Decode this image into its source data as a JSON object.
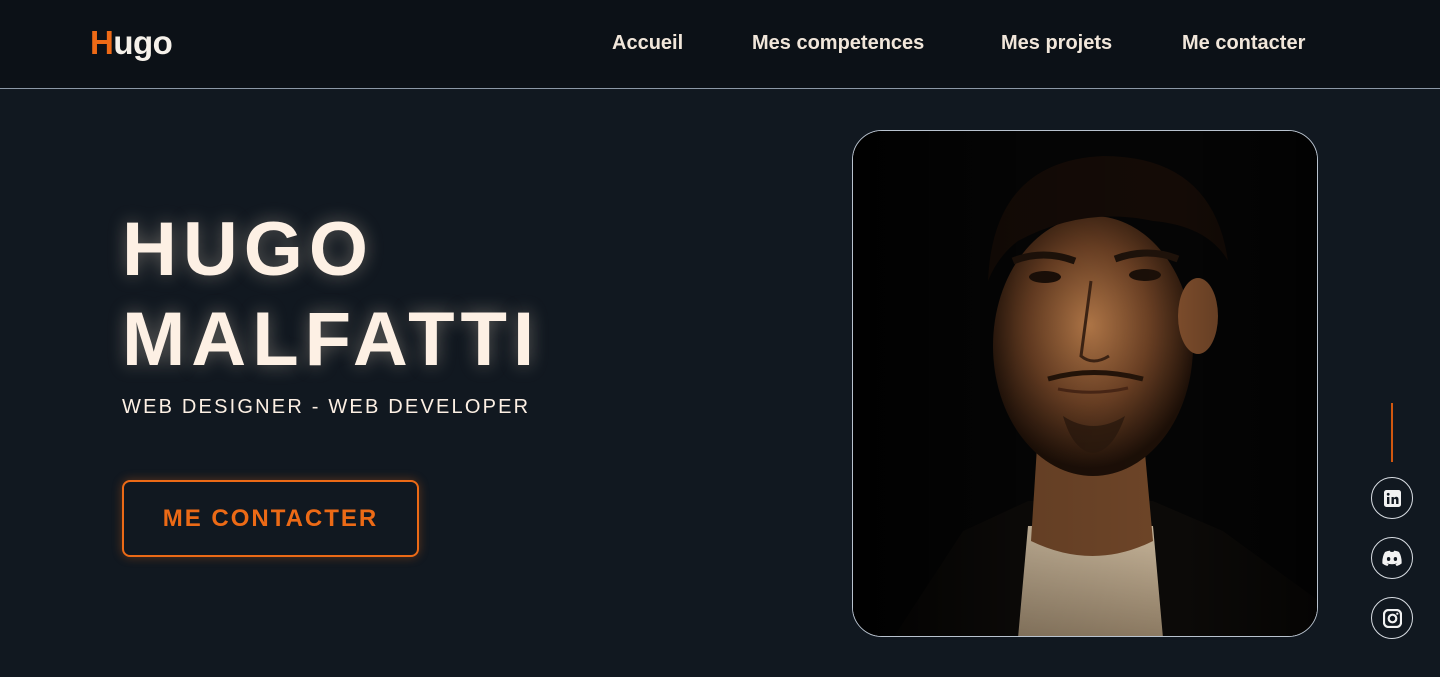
{
  "header": {
    "logo_mark": "H",
    "logo_text": "ugo",
    "nav": [
      {
        "label": "Accueil"
      },
      {
        "label": "Mes competences"
      },
      {
        "label": "Mes projets"
      },
      {
        "label": "Me contacter"
      }
    ]
  },
  "hero": {
    "first_name": "HUGO",
    "last_name": "MALFATTI",
    "subtitle": "WEB DESIGNER - WEB DEVELOPER",
    "cta_label": "ME CONTACTER"
  },
  "portrait": {
    "alt": "Portrait of Hugo Malfatti"
  },
  "social": [
    {
      "icon": "linkedin-icon"
    },
    {
      "icon": "discord-icon"
    },
    {
      "icon": "instagram-icon"
    }
  ],
  "colors": {
    "background": "#111820",
    "header_background": "#0c1117",
    "accent": "#ec6a16",
    "text": "#fdf0e4"
  }
}
